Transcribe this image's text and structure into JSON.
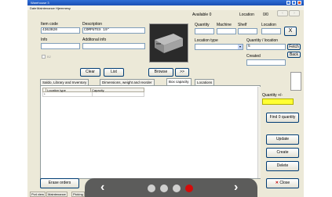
{
  "window": {
    "title": "Warehouse 3"
  },
  "menu": [
    "Date",
    "Maintenance",
    "Hjemmesy"
  ],
  "header": {
    "available_label": "Available 0",
    "location_label": "Location",
    "location_count": "0/0"
  },
  "item": {
    "item_code_label": "Item code",
    "item_code_value": "4363020",
    "description_label": "Description",
    "description_value": "COMPUTEX 19\"",
    "info_label": "Info",
    "additional_info_label": "Additonal info",
    "checkbox_label": "B2"
  },
  "location": {
    "quantity_label": "Quantity",
    "machine_label": "Machine",
    "shelf_label": "Shelf",
    "location_label": "Location",
    "x_button": "X",
    "location_type_label": "Location type",
    "qty_per_location_label": "Quantity / location",
    "qty_per_location_value": "5",
    "fetch_button": "Fetch",
    "created_label": "Created",
    "back_button": "Back"
  },
  "toolbar": {
    "clear_button": "Clear",
    "list_button": "List",
    "browse_button": "Browse",
    "next_button": ">>"
  },
  "tabs": [
    "Saldo, Library and Inventory",
    "Dimensions, weight and reorder",
    "Box capacity",
    "Locations"
  ],
  "grid": {
    "columns": [
      "Location type",
      "Capacity"
    ],
    "row_marker": "*"
  },
  "side": {
    "quantity_pm_label": "Quantity +/-",
    "find_button": "Find 0 quantity",
    "update_button": "Update",
    "create_button": "Create",
    "delete_button": "Delete",
    "close_button": "Close"
  },
  "footer": {
    "erase_orders_button": "Erase orders",
    "status_tabs": [
      "Pvd view",
      "Maintenance",
      "Picking"
    ]
  },
  "overlay": {
    "prev_glyph": "‹",
    "next_glyph": "›"
  },
  "colors": {
    "quantity_highlight": "#ffff33",
    "active_dot": "#d40000"
  }
}
